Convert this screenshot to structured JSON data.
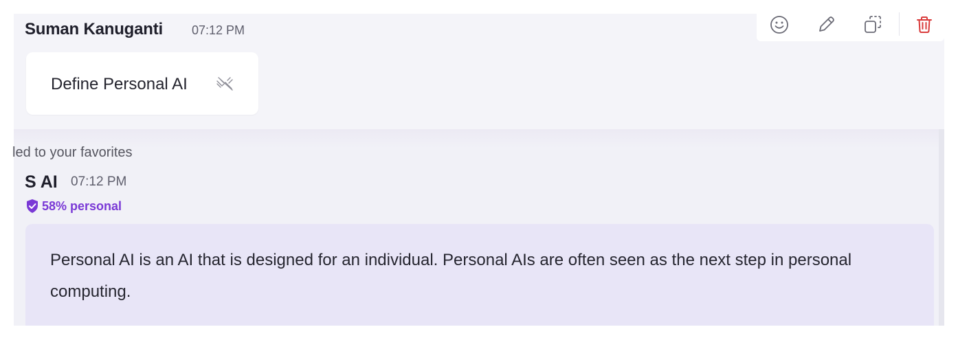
{
  "user_message": {
    "sender": "Suman Kanuganti",
    "time": "07:12 PM",
    "text": "Define Personal AI",
    "status_icon": "mute-icon"
  },
  "toolbar": {
    "icons": [
      "emoji-icon",
      "pencil-icon",
      "copy-icon",
      "trash-icon"
    ],
    "delete_color": "#d93a3a"
  },
  "notice": {
    "text": "led to your favorites"
  },
  "ai_message": {
    "sender": "S AI",
    "time": "07:12 PM",
    "badge": "58% personal",
    "badge_icon": "shield-check-icon",
    "badge_color": "#7a39d6",
    "text": "Personal AI is an AI that is designed for an individual. Personal AIs are often seen as the next step in personal computing."
  },
  "colors": {
    "ai_bubble": "#e8e5f7",
    "panel": "#f4f4f9"
  }
}
